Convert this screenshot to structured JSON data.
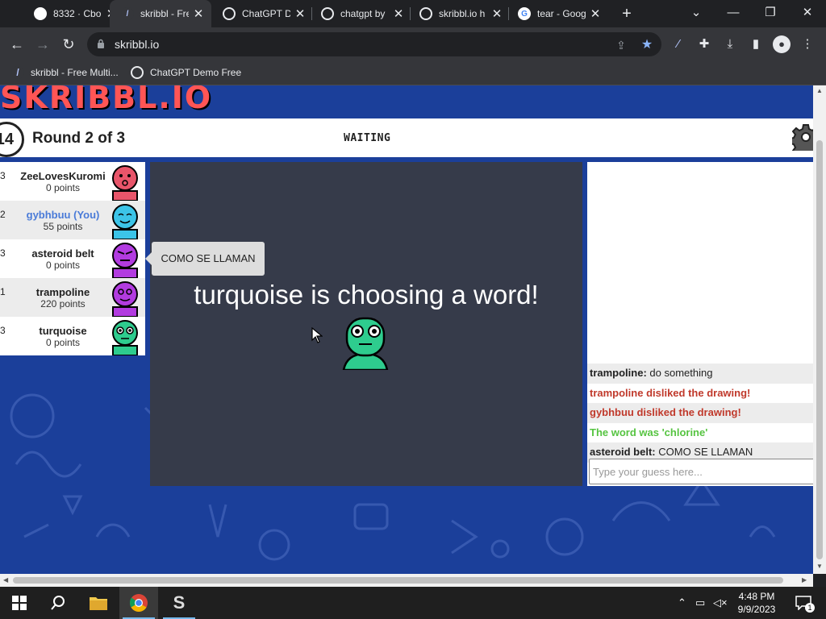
{
  "browser": {
    "tabs": [
      {
        "title": "8332 · Cbo",
        "active": false
      },
      {
        "title": "skribbl - Fre",
        "active": true
      },
      {
        "title": "ChatGPT D",
        "active": false
      },
      {
        "title": "chatgpt by",
        "active": false
      },
      {
        "title": "skribbl.io h",
        "active": false
      },
      {
        "title": "tear - Goog",
        "active": false
      }
    ],
    "url": "skribbl.io",
    "bookmarks": [
      "skribbl - Free Multi...",
      "ChatGPT Demo Free"
    ]
  },
  "game": {
    "logo": "SKRIBBL.IO",
    "timer": "14",
    "round": "Round 2 of 3",
    "status": "WAITING",
    "players": [
      {
        "rank": "3",
        "name": "ZeeLovesKuromi",
        "points": "0 points",
        "color": "#e8556a"
      },
      {
        "rank": "2",
        "name": "gybhbuu (You)",
        "points": "55 points",
        "color": "#3cc4e8"
      },
      {
        "rank": "3",
        "name": "asteroid belt",
        "points": "0 points",
        "color": "#b23be0"
      },
      {
        "rank": "1",
        "name": "trampoline",
        "points": "220 points",
        "color": "#b23be0"
      },
      {
        "rank": "3",
        "name": "turquoise",
        "points": "0 points",
        "color": "#2ecc8e"
      }
    ],
    "speech_bubble": "COMO SE LLAMAN",
    "canvas_message": "turquoise is choosing a word!",
    "chat": [
      {
        "sender": "trampoline:",
        "text": "do something",
        "type": "normal"
      },
      {
        "sender": "",
        "text": "trampoline disliked the drawing!",
        "type": "red"
      },
      {
        "sender": "",
        "text": "gybhbuu disliked the drawing!",
        "type": "red"
      },
      {
        "sender": "",
        "text": "The word was 'chlorine'",
        "type": "green"
      },
      {
        "sender": "asteroid belt:",
        "text": "COMO SE LLAMAN",
        "type": "normal"
      }
    ],
    "guess_placeholder": "Type your guess here..."
  },
  "taskbar": {
    "time": "4:48 PM",
    "date": "9/9/2023",
    "notifications": "1"
  }
}
